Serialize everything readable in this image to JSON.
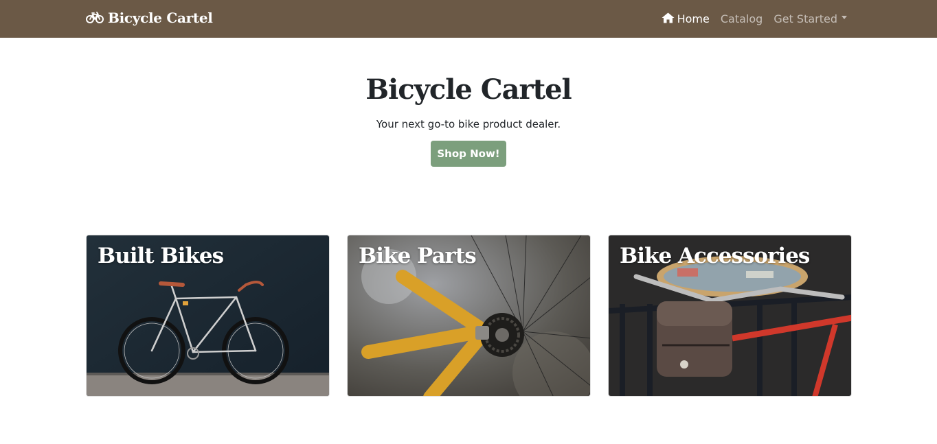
{
  "navbar": {
    "brand": "Bicycle Cartel",
    "brand_icon": "bicycle-icon",
    "links": [
      {
        "label": "Home",
        "icon": "home-icon",
        "active": true
      },
      {
        "label": "Catalog",
        "active": false
      },
      {
        "label": "Get Started",
        "dropdown": true,
        "active": false
      }
    ],
    "color": "#6b5946"
  },
  "hero": {
    "title": "Bicycle Cartel",
    "tagline": "Your next go-to bike product dealer.",
    "button_label": "Shop Now!",
    "button_color": "#7c9f7d"
  },
  "categories": [
    {
      "title": "Built Bikes"
    },
    {
      "title": "Bike Parts"
    },
    {
      "title": "Bike Accessories"
    }
  ]
}
